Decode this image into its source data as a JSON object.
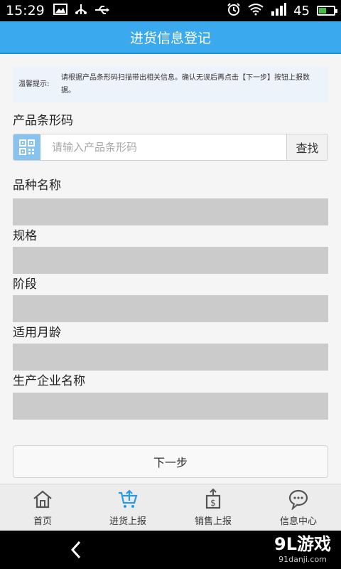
{
  "status_bar": {
    "time": "15:29",
    "battery": "45",
    "icons": [
      "image-icon",
      "usb-icon",
      "usb-debug-icon",
      "alarm-icon",
      "wifi-icon",
      "signal-icon",
      "battery-icon"
    ]
  },
  "header": {
    "title": "进货信息登记"
  },
  "tip": {
    "label": "温馨提示:",
    "text": "请根据产品条形码扫描带出相关信息。确认无误后再点击【下一步】按钮上报数据。"
  },
  "barcode": {
    "label": "产品条形码",
    "placeholder": "请输入产品条形码",
    "search_label": "查找"
  },
  "fields": [
    {
      "label": "品种名称",
      "value": ""
    },
    {
      "label": "规格",
      "value": ""
    },
    {
      "label": "阶段",
      "value": ""
    },
    {
      "label": "适用月龄",
      "value": ""
    },
    {
      "label": "生产企业名称",
      "value": ""
    }
  ],
  "next_label": "下一步",
  "tabs": [
    {
      "label": "首页",
      "icon": "home-icon"
    },
    {
      "label": "进货上报",
      "icon": "cart-upload-icon",
      "active": true
    },
    {
      "label": "销售上报",
      "icon": "sales-report-icon"
    },
    {
      "label": "信息中心",
      "icon": "message-icon"
    }
  ],
  "watermark": {
    "logo": "9L游戏",
    "sub": "91danji.com"
  },
  "colors": {
    "header": "#3aa9ee",
    "accent": "#2a9ae3",
    "field": "#cbcbcb"
  }
}
